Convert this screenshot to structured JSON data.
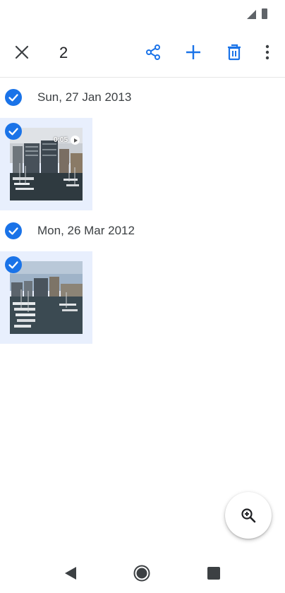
{
  "toolbar": {
    "selected_count": "2"
  },
  "groups": [
    {
      "date": "Sun, 27 Jan 2013",
      "is_video": true,
      "duration": "0:05"
    },
    {
      "date": "Mon, 26 Mar 2012",
      "is_video": false
    }
  ],
  "colors": {
    "accent": "#1a73e8",
    "selection_bg": "#e8effd",
    "icon_dark": "#5f6368"
  },
  "icons": {
    "close": "close-icon",
    "share": "share-icon",
    "add": "add-icon",
    "delete": "delete-icon",
    "more": "more-vert-icon",
    "check": "check-circle-icon",
    "zoom": "zoom-in-icon",
    "back": "nav-back-icon",
    "home": "nav-home-icon",
    "recents": "nav-recents-icon"
  }
}
